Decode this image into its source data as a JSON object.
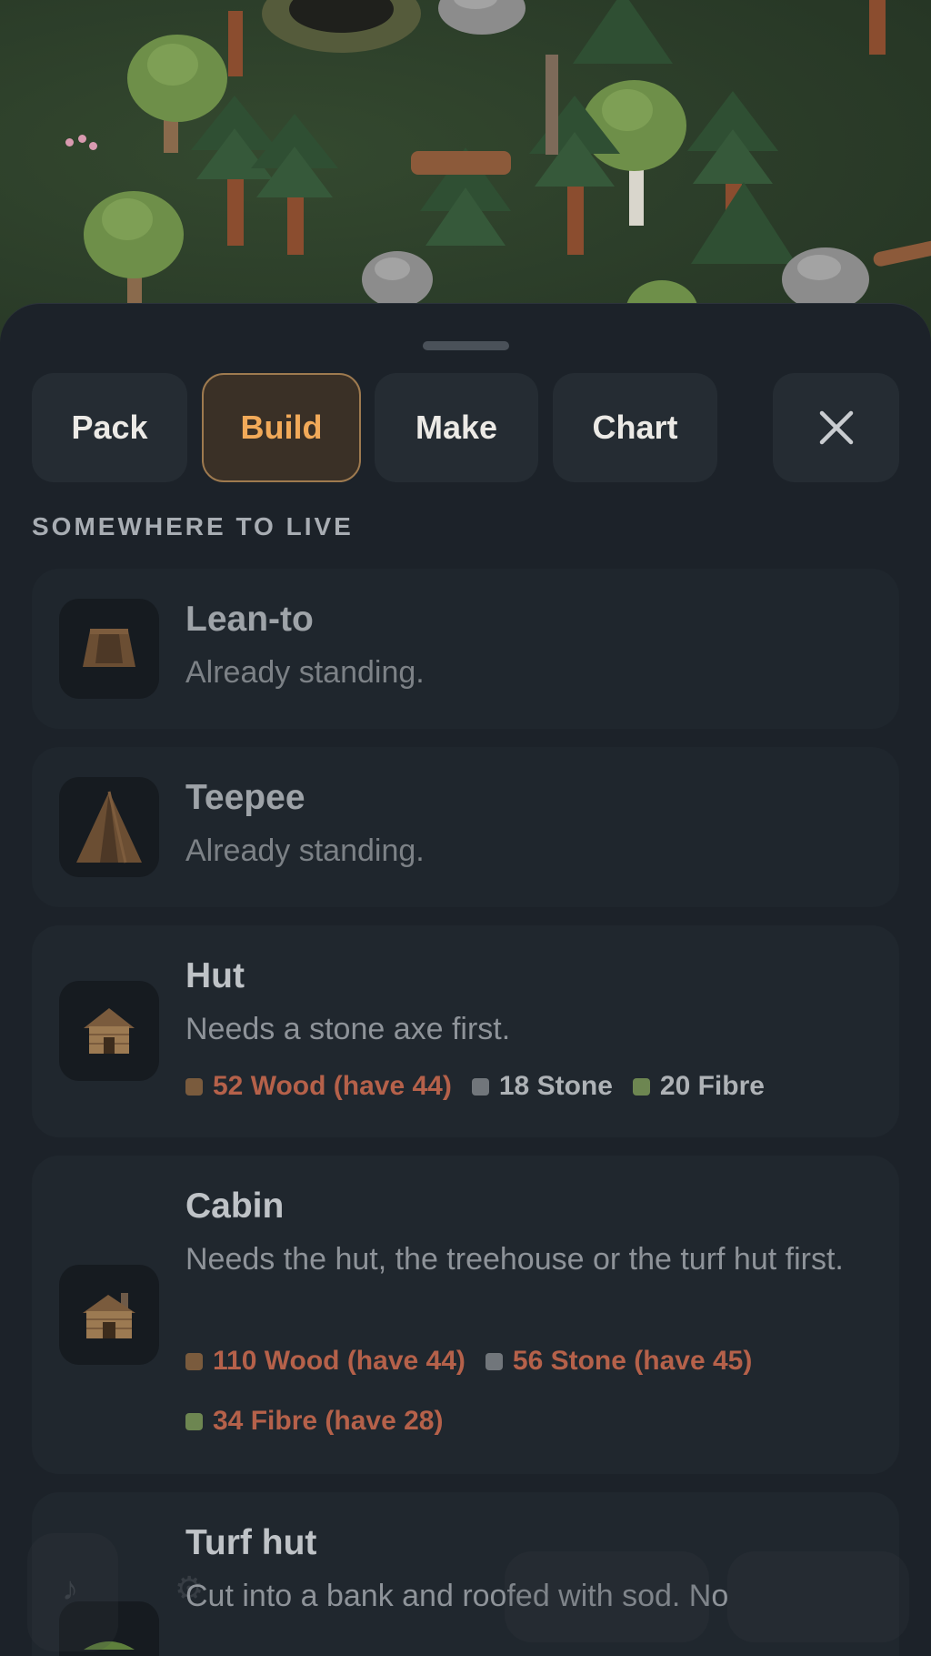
{
  "tabs": [
    {
      "label": "Pack",
      "active": false
    },
    {
      "label": "Build",
      "active": true
    },
    {
      "label": "Make",
      "active": false
    },
    {
      "label": "Chart",
      "active": false
    }
  ],
  "close_icon": "close-icon",
  "section": {
    "title": "SOMEWHERE TO LIVE"
  },
  "cards": [
    {
      "name": "Lean-to",
      "desc": "Already standing.",
      "icon": "lean-to-icon",
      "status": "built"
    },
    {
      "name": "Teepee",
      "desc": "Already standing.",
      "icon": "teepee-icon",
      "status": "built"
    },
    {
      "name": "Hut",
      "desc": "Needs a stone axe first.",
      "icon": "hut-icon",
      "reqs": [
        {
          "text": "52 Wood (have 44)",
          "short": true,
          "color": "#7a5b3d"
        },
        {
          "text": "18 Stone",
          "short": false,
          "color": "#71767b"
        },
        {
          "text": "20 Fibre",
          "short": false,
          "color": "#6d8651"
        }
      ]
    },
    {
      "name": "Cabin",
      "desc": "Needs the hut, the treehouse or the turf hut first.",
      "icon": "cabin-icon",
      "reqs": [
        {
          "text": "110 Wood (have 44)",
          "short": true,
          "color": "#7a5b3d"
        },
        {
          "text": "56 Stone (have 45)",
          "short": true,
          "color": "#71767b"
        },
        {
          "text": "34 Fibre (have 28)",
          "short": true,
          "color": "#6d8651"
        }
      ]
    },
    {
      "name": "Turf hut",
      "desc": "Cut into a bank and roofed with sod. No",
      "icon": "turf-hut-icon"
    }
  ],
  "colors": {
    "accent": "#f2aa59",
    "short": "#b5614a"
  }
}
